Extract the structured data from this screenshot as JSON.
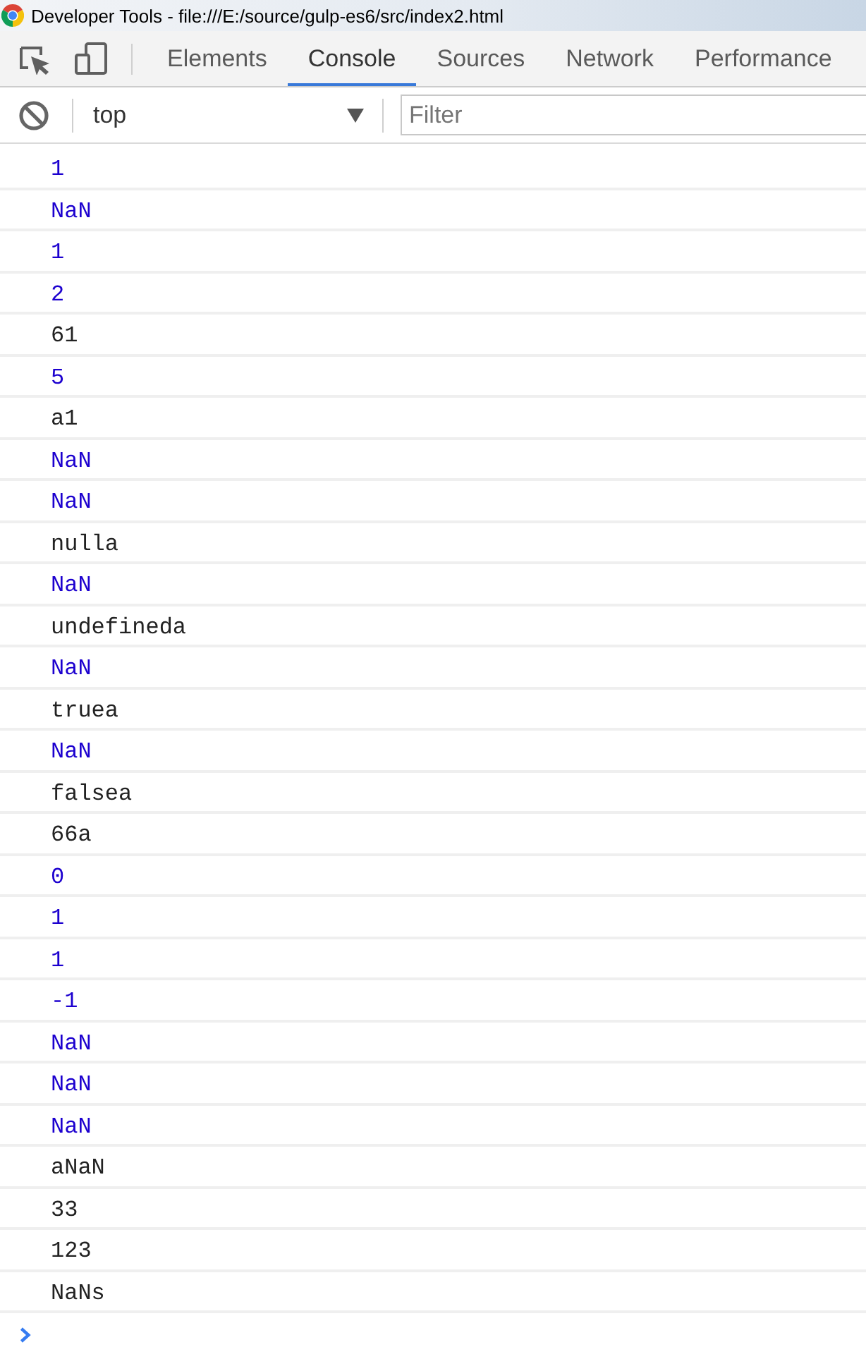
{
  "window": {
    "title": "Developer Tools - file:///E:/source/gulp-es6/src/index2.html"
  },
  "tabs": [
    {
      "label": "Elements",
      "selected": false
    },
    {
      "label": "Console",
      "selected": true
    },
    {
      "label": "Sources",
      "selected": false
    },
    {
      "label": "Network",
      "selected": false
    },
    {
      "label": "Performance",
      "selected": false
    }
  ],
  "toolbar": {
    "context": "top",
    "filter": {
      "placeholder": "Filter"
    }
  },
  "messages": [
    {
      "kind": "number",
      "text": "1"
    },
    {
      "kind": "number",
      "text": "NaN"
    },
    {
      "kind": "number",
      "text": "1"
    },
    {
      "kind": "number",
      "text": "2"
    },
    {
      "kind": "string",
      "text": "61"
    },
    {
      "kind": "number",
      "text": "5"
    },
    {
      "kind": "string",
      "text": "a1"
    },
    {
      "kind": "number",
      "text": "NaN"
    },
    {
      "kind": "number",
      "text": "NaN"
    },
    {
      "kind": "string",
      "text": "nulla"
    },
    {
      "kind": "number",
      "text": "NaN"
    },
    {
      "kind": "string",
      "text": "undefineda"
    },
    {
      "kind": "number",
      "text": "NaN"
    },
    {
      "kind": "string",
      "text": "truea"
    },
    {
      "kind": "number",
      "text": "NaN"
    },
    {
      "kind": "string",
      "text": "falsea"
    },
    {
      "kind": "string",
      "text": "66a"
    },
    {
      "kind": "number",
      "text": "0"
    },
    {
      "kind": "number",
      "text": "1"
    },
    {
      "kind": "number",
      "text": "1"
    },
    {
      "kind": "number",
      "text": "-1"
    },
    {
      "kind": "number",
      "text": "NaN"
    },
    {
      "kind": "number",
      "text": "NaN"
    },
    {
      "kind": "number",
      "text": "NaN"
    },
    {
      "kind": "string",
      "text": "aNaN"
    },
    {
      "kind": "string",
      "text": "33"
    },
    {
      "kind": "string",
      "text": "123"
    },
    {
      "kind": "string",
      "text": "NaNs"
    }
  ]
}
